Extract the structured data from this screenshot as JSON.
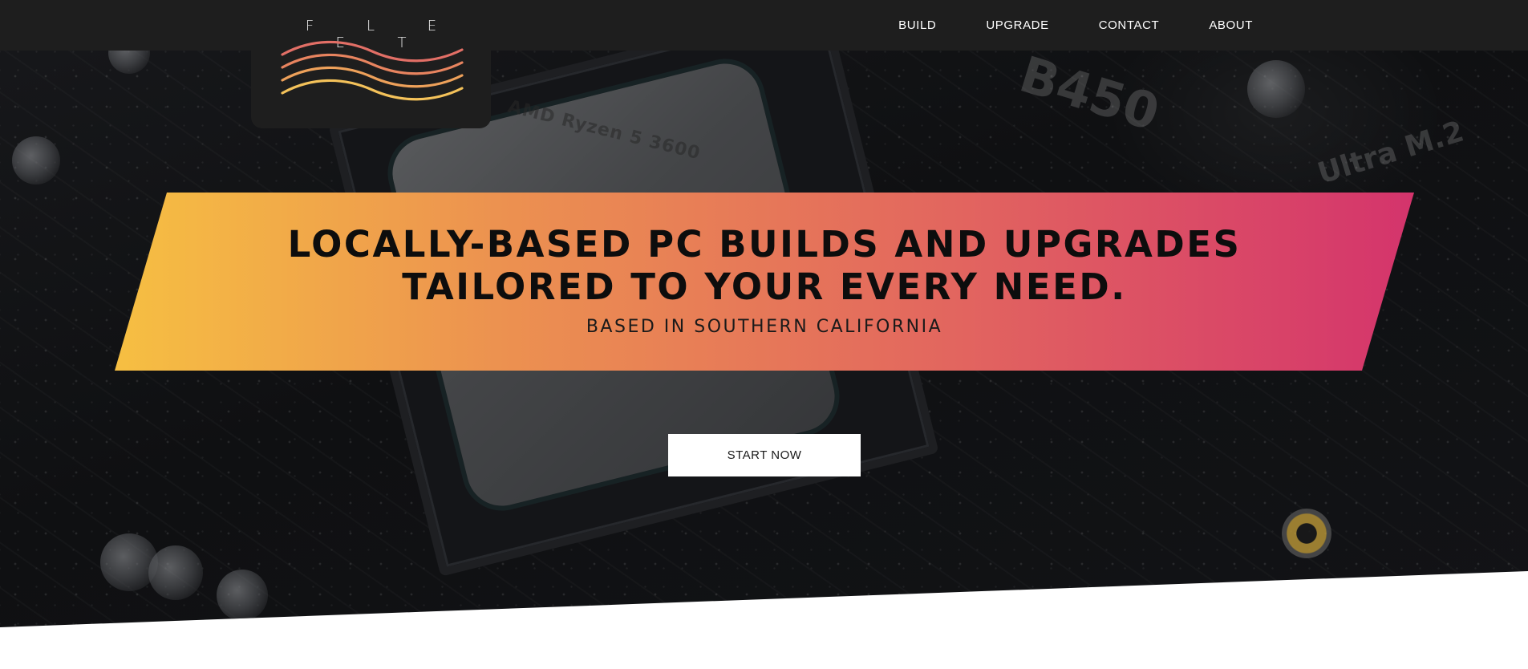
{
  "brand": {
    "logo_text": "F L E E T",
    "wave_colors": [
      "#e26f66",
      "#e8845f",
      "#eea15a",
      "#f4c25a"
    ]
  },
  "nav": {
    "items": [
      {
        "label": "BUILD"
      },
      {
        "label": "UPGRADE"
      },
      {
        "label": "CONTACT"
      },
      {
        "label": "ABOUT"
      }
    ]
  },
  "hero": {
    "headline_line1": "LOCALLY-BASED PC BUILDS AND UPGRADES",
    "headline_line2": "TAILORED TO YOUR EVERY NEED.",
    "subheadline": "BASED IN SOUTHERN CALIFORNIA",
    "cta_label": "START NOW",
    "banner_gradient": [
      "#f6bf42",
      "#ec9150",
      "#e2655f",
      "#d4346c"
    ],
    "background_image": {
      "chip_text": "AMD Ryzen 5 3600",
      "board_text_1": "B450",
      "board_text_2": "Ultra M.2"
    }
  },
  "colors": {
    "navbar_bg": "#1e1e1e",
    "cta_bg": "#ffffff",
    "page_bg": "#ffffff"
  }
}
